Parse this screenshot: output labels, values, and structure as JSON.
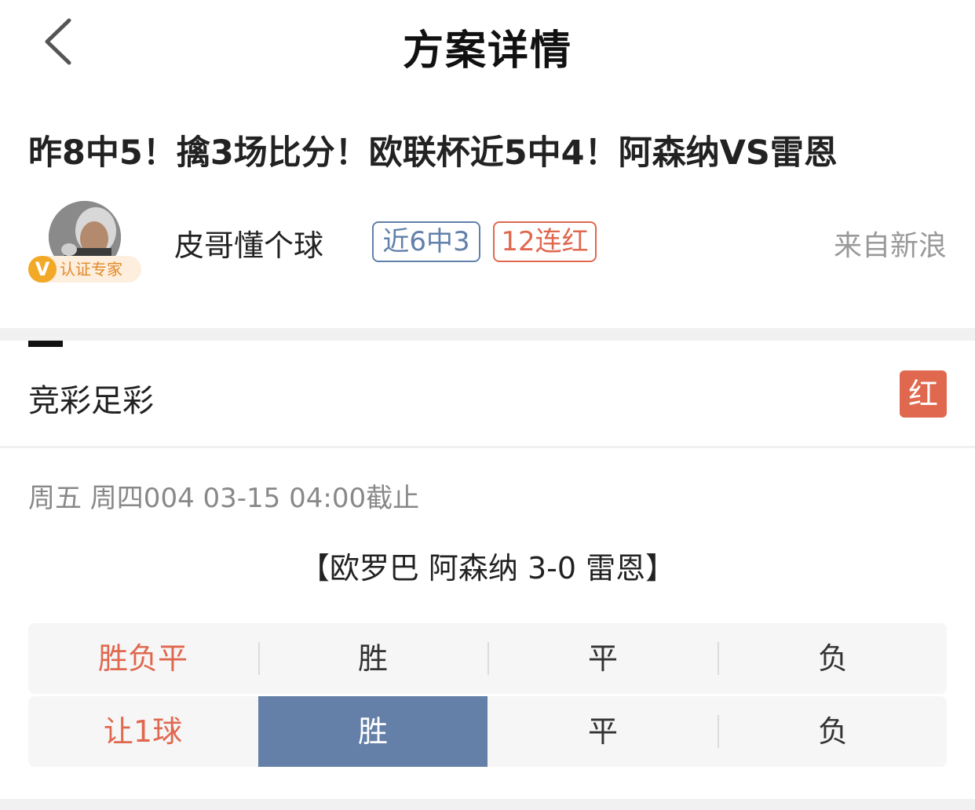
{
  "nav": {
    "back_icon": "chevron-left-icon",
    "title": "方案详情"
  },
  "article": {
    "headline": "昨8中5！擒3场比分！欧联杯近5中4！阿森纳VS雷恩"
  },
  "author": {
    "name": "皮哥懂个球",
    "cert_icon": "v-badge-icon",
    "cert_label": "认证专家",
    "badges": [
      "近6中3",
      "12连红"
    ],
    "source": "来自新浪"
  },
  "lottery": {
    "type": "竞彩足彩",
    "result": "红"
  },
  "match": {
    "meta": "周五 周四004 03-15 04:00截止",
    "title": "【欧罗巴 阿森纳 3-0 雷恩】"
  },
  "odds_rows": [
    {
      "label": "胜负平",
      "options": [
        "胜",
        "平",
        "负"
      ],
      "selected": null
    },
    {
      "label": "让1球",
      "options": [
        "胜",
        "平",
        "负"
      ],
      "selected": "胜"
    }
  ],
  "colors": {
    "accent_red": "#e0684f",
    "accent_blue": "#6180aa",
    "selected_fill": "#6480a8",
    "cert_orange": "#f3a928"
  }
}
